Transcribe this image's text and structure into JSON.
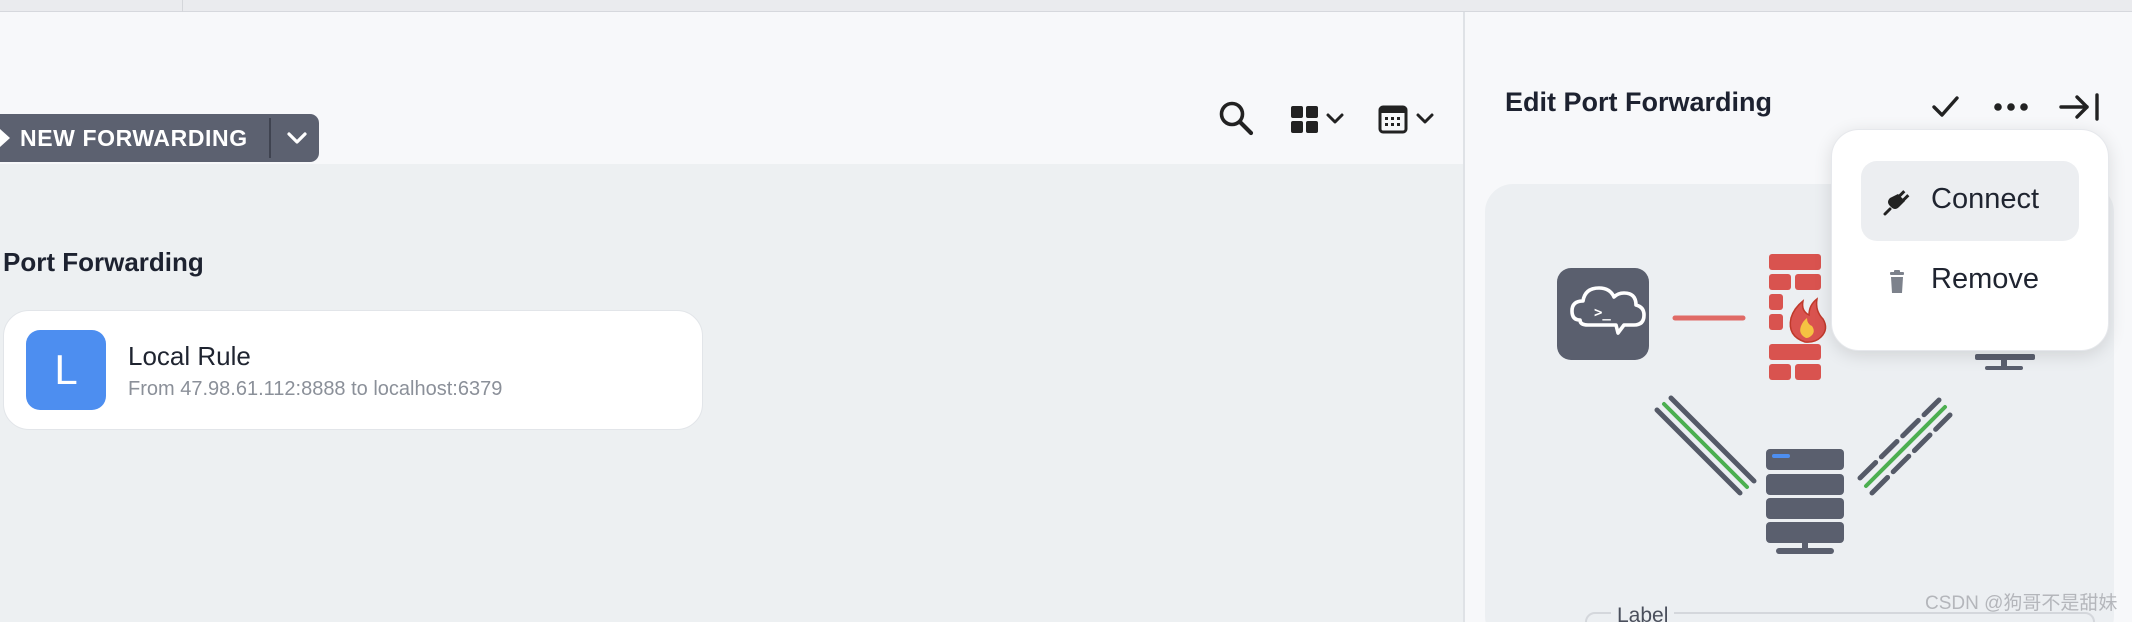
{
  "toolbar": {
    "new_forwarding_label": "NEW FORWARDING",
    "icons": [
      "search-icon",
      "grid-view-icon",
      "calendar-icon"
    ]
  },
  "main": {
    "section_title": "Port Forwarding",
    "rules": [
      {
        "avatar_letter": "L",
        "title": "Local Rule",
        "subtitle": "From 47.98.61.112:8888 to localhost:6379",
        "avatar_color": "#4d8ef0"
      }
    ]
  },
  "panel": {
    "title": "Edit Port Forwarding",
    "icons": [
      "check-icon",
      "more-icon",
      "collapse-panel-icon"
    ],
    "label_field_label": "Label"
  },
  "menu": {
    "items": [
      {
        "label": "Connect",
        "icon": "plug-icon"
      },
      {
        "label": "Remove",
        "icon": "trash-icon"
      }
    ]
  },
  "watermark": "CSDN @狗哥不是甜妹",
  "colors": {
    "button_bg": "#5c6170",
    "accent_blue": "#4d8ef0",
    "firewall_red": "#d9534f",
    "link_green": "#4caf50"
  }
}
